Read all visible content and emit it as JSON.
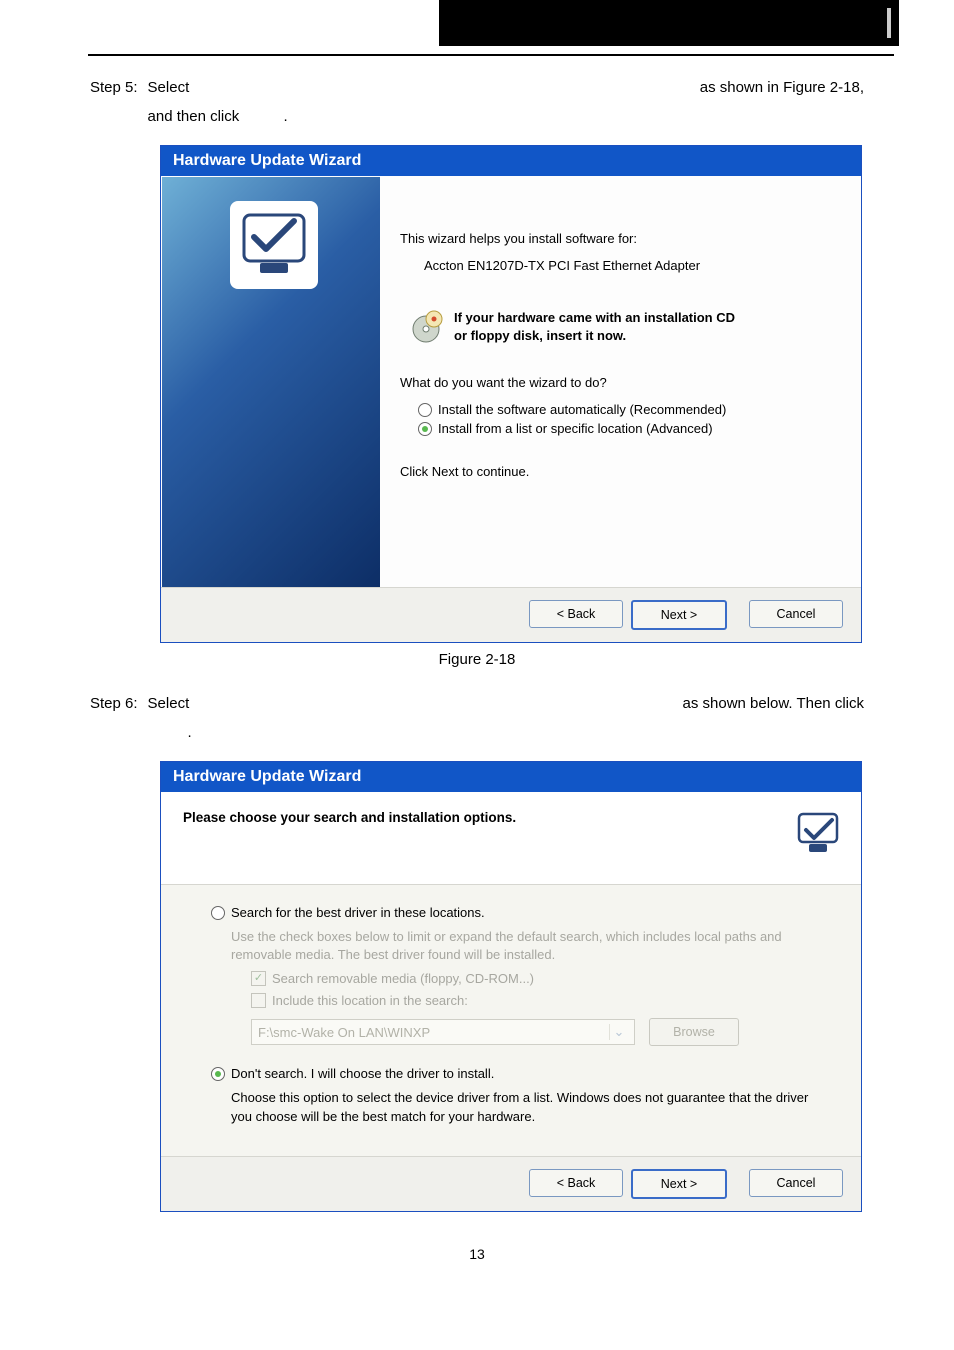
{
  "doc": {
    "step5": {
      "no": "Step 5:",
      "a": "Select",
      "b": "as shown in Figure   2-18,",
      "c": "and then click",
      "d": "."
    },
    "fig1": "Figure 2-18",
    "step6": {
      "no": "Step 6:",
      "a": "Select",
      "b": "as shown below. Then click",
      "c": "."
    },
    "pagenum": "13"
  },
  "dlg1": {
    "title": "Hardware Update Wizard",
    "intro": "This wizard helps you install software for:",
    "device": "Accton EN1207D-TX PCI Fast Ethernet Adapter",
    "cd_line1": "If your hardware came with an installation CD",
    "cd_line2": "or floppy disk, insert it now.",
    "prompt": "What do you want the wizard to do?",
    "opt1": "Install the software automatically (Recommended)",
    "opt2": "Install from a list or specific location (Advanced)",
    "next_hint": "Click Next to continue.",
    "back": "< Back",
    "next": "Next >",
    "cancel": "Cancel"
  },
  "dlg2": {
    "title": "Hardware Update Wizard",
    "header": "Please choose your search and installation options.",
    "opt1": "Search for the best driver in these locations.",
    "opt1_desc": "Use the check boxes below to limit or expand the default search, which includes local paths and removable media. The best driver found will be installed.",
    "chk1": "Search removable media (floppy, CD-ROM...)",
    "chk2": "Include this location in the search:",
    "path": "F:\\smc-Wake On LAN\\WINXP",
    "browse": "Browse",
    "opt2": "Don't search. I will choose the driver to install.",
    "opt2_desc": "Choose this option to select the device driver from a list.  Windows does not guarantee that the driver you choose will be the best match for your hardware.",
    "back": "< Back",
    "next": "Next >",
    "cancel": "Cancel"
  }
}
